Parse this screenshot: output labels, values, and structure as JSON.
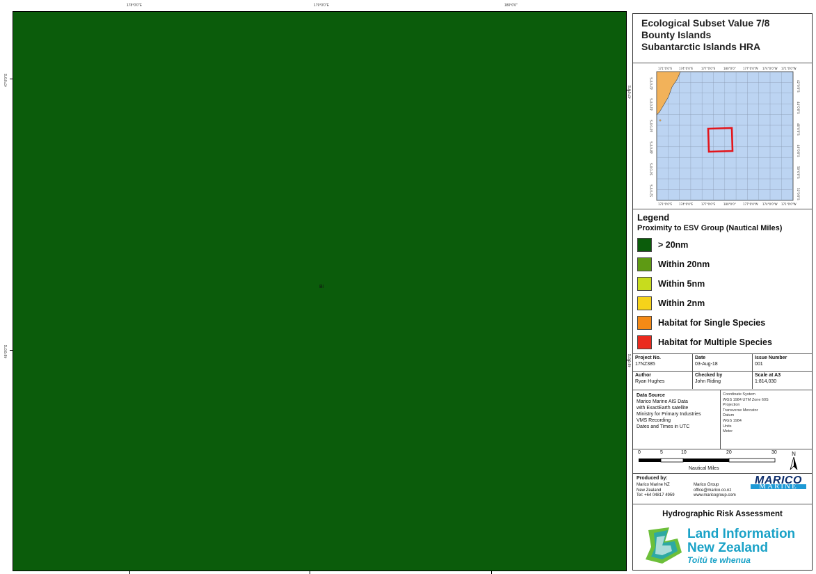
{
  "map": {
    "top_ticks": [
      "178°0'0\"E",
      "179°0'0\"E",
      "180°0'0\""
    ],
    "left_ticks": [
      "47°0'0\"S",
      "48°0'0\"S"
    ],
    "right_ticks": [
      "47°0'0\"S",
      "48°0'0\"S"
    ],
    "island_label": "BI",
    "background_color": "#0b5c0b"
  },
  "panel": {
    "title_lines": [
      "Ecological Subset Value 7/8",
      "Bounty Islands",
      "Subantarctic Islands HRA"
    ],
    "legend": {
      "title": "Legend",
      "subtitle": "Proximity to ESV Group (Nautical Miles)",
      "items": [
        {
          "label": "> 20nm",
          "color": "#0b5c0b"
        },
        {
          "label": "Within 20nm",
          "color": "#5e9a14"
        },
        {
          "label": "Within 5nm",
          "color": "#c7dc1e"
        },
        {
          "label": "Within 2nm",
          "color": "#f6d31a"
        },
        {
          "label": "Habitat for Single Species",
          "color": "#f58a16"
        },
        {
          "label": "Habitat for Multiple Species",
          "color": "#ea2a1e"
        }
      ]
    },
    "meta": {
      "project_no_label": "Project No.",
      "project_no": "17NZ385",
      "date_label": "Date",
      "date": "03-Aug-18",
      "issue_label": "Issue Number",
      "issue": "001",
      "author_label": "Author",
      "author": "Ryan Hughes",
      "checked_label": "Checked by",
      "checked": "John Riding",
      "scale_label": "Scale at A3",
      "scale": "1:814,030"
    },
    "source": {
      "heading": "Data Source",
      "lines": [
        "Marico Marine AIS Data",
        "with ExactEarth satellite",
        "Ministry for Primary Industries",
        "VMS Recording",
        "Dates and Times in UTC"
      ],
      "coord_lines": [
        "Coordinate System",
        "WGS 1984 UTM Zone 60S",
        "Projection",
        "Transverse Mercator",
        "Datum",
        "WGS 1984",
        "Units",
        "Meter"
      ]
    },
    "scalebar": {
      "labels": [
        "0",
        "5",
        "10",
        "20",
        "30"
      ],
      "unit": "Nautical Miles",
      "north": "N"
    },
    "produced": {
      "heading": "Produced by:",
      "col1": [
        "Marico Marine NZ",
        "New Zealand",
        "Tel: +64 04817 4959"
      ],
      "col2": [
        "Marico Group",
        "office@marico.co.nz",
        "www.maricogroup.com"
      ],
      "logo_top": "MARICO",
      "logo_bottom": "MARINE"
    },
    "footer": {
      "title": "Hydrographic Risk Assessment",
      "linz_line1": "Land Information",
      "linz_line2": "New Zealand",
      "linz_line3": "Toitū te whenua"
    },
    "inset": {
      "top_ticks": [
        "171°0'0\"E",
        "174°0'0\"E",
        "177°0'0\"E",
        "180°0'0\"",
        "177°0'0\"W",
        "174°0'0\"W",
        "171°0'0\"W"
      ],
      "bottom_ticks": [
        "171°0'0\"E",
        "174°0'0\"E",
        "177°0'0\"E",
        "180°0'0\"",
        "177°0'0\"W",
        "174°0'0\"W",
        "171°0'0\"W"
      ],
      "side_ticks": [
        "42°0'0\"S",
        "44°0'0\"S",
        "46°0'0\"S",
        "48°0'0\"S",
        "50°0'0\"S",
        "52°0'0\"S"
      ]
    }
  }
}
